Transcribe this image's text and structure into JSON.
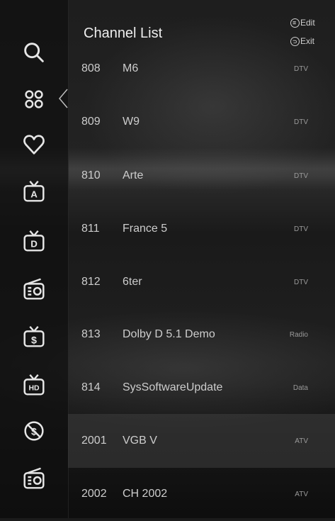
{
  "header": {
    "title": "Channel List",
    "edit_label": "Edit",
    "exit_label": "Exit"
  },
  "sidebar": {
    "items": [
      {
        "icon": "search-icon"
      },
      {
        "icon": "apps-icon"
      },
      {
        "icon": "heart-icon"
      },
      {
        "icon": "tv-a-icon"
      },
      {
        "icon": "tv-d-icon"
      },
      {
        "icon": "radio-icon"
      },
      {
        "icon": "tv-paid-icon"
      },
      {
        "icon": "tv-hd-icon"
      },
      {
        "icon": "free-icon"
      },
      {
        "icon": "radio-icon"
      }
    ]
  },
  "channels": [
    {
      "number": "808",
      "name": "M6",
      "type": "DTV"
    },
    {
      "number": "809",
      "name": "W9",
      "type": "DTV"
    },
    {
      "number": "810",
      "name": "Arte",
      "type": "DTV"
    },
    {
      "number": "811",
      "name": "France 5",
      "type": "DTV"
    },
    {
      "number": "812",
      "name": "6ter",
      "type": "DTV"
    },
    {
      "number": "813",
      "name": "Dolby D 5.1 Demo",
      "type": "Radio"
    },
    {
      "number": "814",
      "name": "SysSoftwareUpdate",
      "type": "Data"
    },
    {
      "number": "2001",
      "name": "VGB V",
      "type": "ATV",
      "selected": true
    },
    {
      "number": "2002",
      "name": "CH 2002",
      "type": "ATV"
    }
  ]
}
